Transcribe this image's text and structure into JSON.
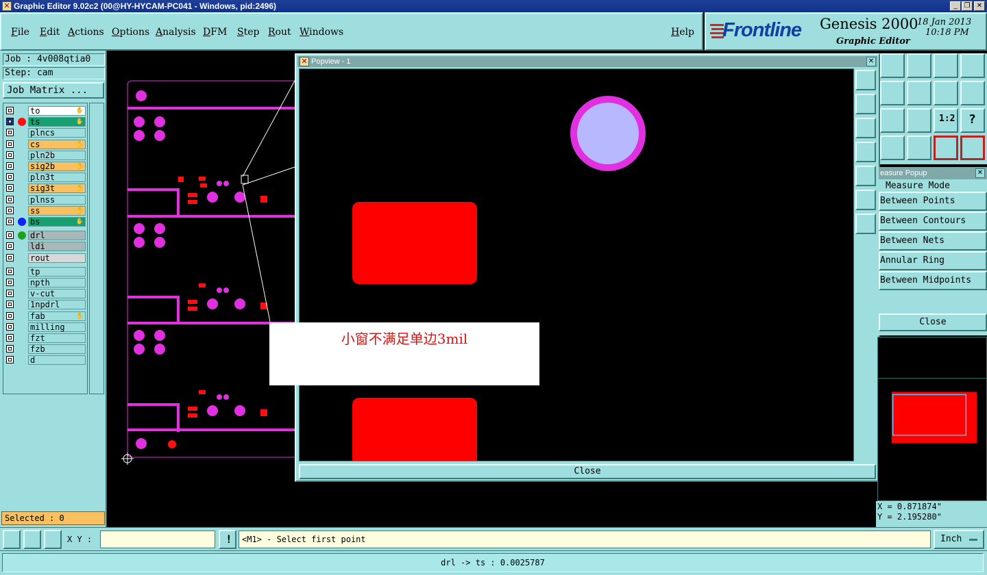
{
  "window": {
    "title": "Graphic Editor 9.02c2 (00@HY-HYCAM-PC041 - Windows, pid:2496)",
    "buttons": [
      "_",
      "❐",
      "✕"
    ]
  },
  "menu": [
    "File",
    "Edit",
    "Actions",
    "Options",
    "Analysis",
    "DFM",
    "Step",
    "Rout",
    "Windows"
  ],
  "help_label": "Help",
  "brand": {
    "logo": "Frontline",
    "product": "Genesis 2000",
    "subtitle": "Graphic Editor",
    "date": "18 Jan 2013",
    "time": "10:18 PM"
  },
  "job": {
    "job_label": "Job : 4v008qtia0",
    "step_label": "Step: cam",
    "matrix_button": "Job Matrix ..."
  },
  "layers": [
    {
      "name": "to",
      "bg": "#ffffff",
      "dot": "",
      "hand": true
    },
    {
      "name": "ts",
      "bg": "#18a070",
      "dot": "#ff1010",
      "hand": true,
      "active": true
    },
    {
      "name": "plncs",
      "bg": "#9fdede",
      "dot": "",
      "hand": false
    },
    {
      "name": "cs",
      "bg": "#f8c060",
      "dot": "",
      "hand": true
    },
    {
      "name": "pln2b",
      "bg": "#9fdede",
      "dot": "",
      "hand": false
    },
    {
      "name": "sig2b",
      "bg": "#f8c060",
      "dot": "",
      "hand": true
    },
    {
      "name": "pln3t",
      "bg": "#9fdede",
      "dot": "",
      "hand": false
    },
    {
      "name": "sig3t",
      "bg": "#f8c060",
      "dot": "",
      "hand": true
    },
    {
      "name": "plnss",
      "bg": "#9fdede",
      "dot": "",
      "hand": false
    },
    {
      "name": "ss",
      "bg": "#f8c060",
      "dot": "",
      "hand": true
    },
    {
      "name": "bs",
      "bg": "#18a070",
      "dot": "#1020ff",
      "hand": true
    },
    {
      "name": "drl",
      "bg": "#a8b8b8",
      "dot": "#20a020",
      "hand": false
    },
    {
      "name": "ldi",
      "bg": "#a8b8b8",
      "dot": "",
      "hand": false
    },
    {
      "name": "rout",
      "bg": "#d8d8d8",
      "dot": "",
      "hand": false
    },
    {
      "name": "tp",
      "bg": "#9fdede",
      "dot": "",
      "hand": false
    },
    {
      "name": "npth",
      "bg": "#9fdede",
      "dot": "",
      "hand": false
    },
    {
      "name": "v-cut",
      "bg": "#9fdede",
      "dot": "",
      "hand": false
    },
    {
      "name": "1npdrl",
      "bg": "#9fdede",
      "dot": "",
      "hand": false
    },
    {
      "name": "fab",
      "bg": "#9fdede",
      "dot": "",
      "hand": true
    },
    {
      "name": "milling",
      "bg": "#9fdede",
      "dot": "",
      "hand": false
    },
    {
      "name": "fzt",
      "bg": "#9fdede",
      "dot": "",
      "hand": false
    },
    {
      "name": "fzb",
      "bg": "#9fdede",
      "dot": "",
      "hand": false
    },
    {
      "name": "d",
      "bg": "#9fdede",
      "dot": "",
      "hand": false
    }
  ],
  "selected_label": "Selected : 0",
  "popview": {
    "title": "Popview - 1",
    "close_label": "Close",
    "close_x": "✕"
  },
  "annotation": "小窗不满足单边3mil",
  "measure": {
    "title": "easure Popup",
    "mode_label": "Measure Mode",
    "options": [
      "Between Points",
      "Between Contours",
      "Between Nets",
      "Annular Ring",
      "Between Midpoints"
    ],
    "close_label": "Close",
    "close_x": "✕"
  },
  "coords": {
    "x": "X = 0.871874\"",
    "y": "Y = 2.195280\""
  },
  "command": {
    "xy_label": "X Y :",
    "xy_value": "",
    "message": "<M1> - Select first point",
    "units": "Inch"
  },
  "status": "drl -> ts : 0.0025787",
  "colors": {
    "panel": "#9fdede",
    "magenta": "#e030e0",
    "pad_red": "#ff0000",
    "ring_fill": "#b8b8ff"
  }
}
